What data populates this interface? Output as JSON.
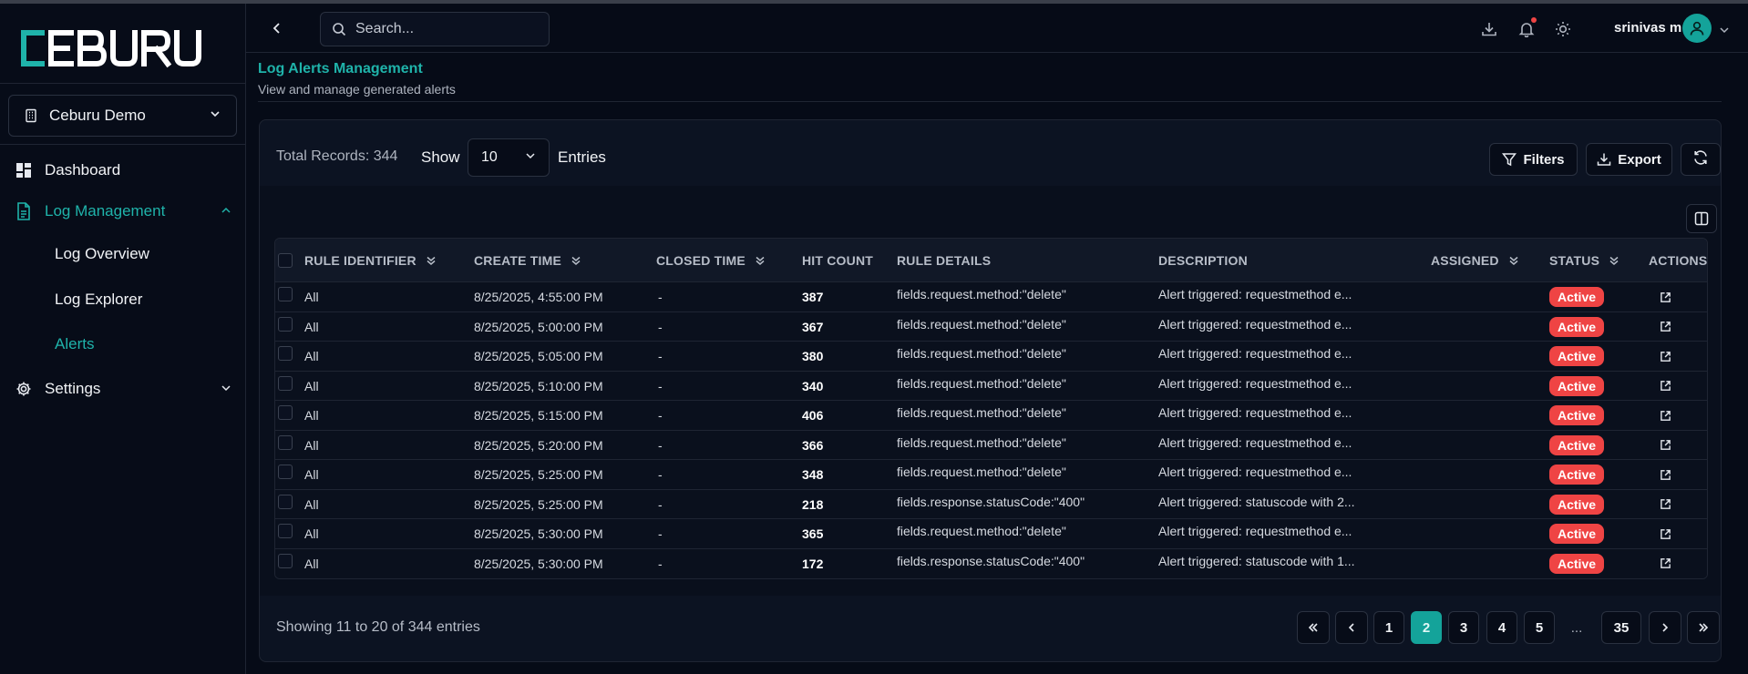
{
  "app": {
    "logo_text": "CEBURU",
    "organization": "Ceburu Demo",
    "accent": "#1fb3aa",
    "danger": "#ef4444"
  },
  "sidebar": {
    "items": [
      {
        "label": "Dashboard",
        "icon": "dashboard-icon"
      },
      {
        "label": "Log Management",
        "icon": "document-icon",
        "expanded": true,
        "active": true
      },
      {
        "label": "Settings",
        "icon": "gear-icon",
        "expanded": false
      }
    ],
    "sub_items": [
      {
        "label": "Log Overview"
      },
      {
        "label": "Log Explorer"
      },
      {
        "label": "Alerts",
        "active": true
      }
    ]
  },
  "header": {
    "search_placeholder": "Search...",
    "user_name": "srinivas m"
  },
  "page": {
    "title": "Log Alerts Management",
    "subtitle": "View and manage generated alerts"
  },
  "toolbar": {
    "total_records_label": "Total Records: 344",
    "show_label": "Show",
    "page_size": "10",
    "entries_label": "Entries",
    "filters_label": "Filters",
    "export_label": "Export"
  },
  "table": {
    "columns": [
      "RULE IDENTIFIER",
      "CREATE TIME",
      "CLOSED TIME",
      "HIT COUNT",
      "RULE DETAILS",
      "DESCRIPTION",
      "ASSIGNED",
      "STATUS",
      "ACTIONS"
    ],
    "rows": [
      {
        "rule": "All",
        "create": "8/25/2025, 4:55:00 PM",
        "closed": "-",
        "hits": "387",
        "details": "fields.request.method:\"delete\"",
        "desc": "Alert triggered: requestmethod e...",
        "assigned": "",
        "status": "Active"
      },
      {
        "rule": "All",
        "create": "8/25/2025, 5:00:00 PM",
        "closed": "-",
        "hits": "367",
        "details": "fields.request.method:\"delete\"",
        "desc": "Alert triggered: requestmethod e...",
        "assigned": "",
        "status": "Active"
      },
      {
        "rule": "All",
        "create": "8/25/2025, 5:05:00 PM",
        "closed": "-",
        "hits": "380",
        "details": "fields.request.method:\"delete\"",
        "desc": "Alert triggered: requestmethod e...",
        "assigned": "",
        "status": "Active"
      },
      {
        "rule": "All",
        "create": "8/25/2025, 5:10:00 PM",
        "closed": "-",
        "hits": "340",
        "details": "fields.request.method:\"delete\"",
        "desc": "Alert triggered: requestmethod e...",
        "assigned": "",
        "status": "Active"
      },
      {
        "rule": "All",
        "create": "8/25/2025, 5:15:00 PM",
        "closed": "-",
        "hits": "406",
        "details": "fields.request.method:\"delete\"",
        "desc": "Alert triggered: requestmethod e...",
        "assigned": "",
        "status": "Active"
      },
      {
        "rule": "All",
        "create": "8/25/2025, 5:20:00 PM",
        "closed": "-",
        "hits": "366",
        "details": "fields.request.method:\"delete\"",
        "desc": "Alert triggered: requestmethod e...",
        "assigned": "",
        "status": "Active"
      },
      {
        "rule": "All",
        "create": "8/25/2025, 5:25:00 PM",
        "closed": "-",
        "hits": "348",
        "details": "fields.request.method:\"delete\"",
        "desc": "Alert triggered: requestmethod e...",
        "assigned": "",
        "status": "Active"
      },
      {
        "rule": "All",
        "create": "8/25/2025, 5:25:00 PM",
        "closed": "-",
        "hits": "218",
        "details": "fields.response.statusCode:\"400\"",
        "desc": "Alert triggered: statuscode with 2...",
        "assigned": "",
        "status": "Active"
      },
      {
        "rule": "All",
        "create": "8/25/2025, 5:30:00 PM",
        "closed": "-",
        "hits": "365",
        "details": "fields.request.method:\"delete\"",
        "desc": "Alert triggered: requestmethod e...",
        "assigned": "",
        "status": "Active"
      },
      {
        "rule": "All",
        "create": "8/25/2025, 5:30:00 PM",
        "closed": "-",
        "hits": "172",
        "details": "fields.response.statusCode:\"400\"",
        "desc": "Alert triggered: statuscode with 1...",
        "assigned": "",
        "status": "Active"
      }
    ]
  },
  "footer": {
    "showing_label": "Showing 11 to 20 of 344 entries",
    "pages": [
      "1",
      "2",
      "3",
      "4",
      "5",
      "...",
      "35"
    ],
    "current_page": "2"
  }
}
